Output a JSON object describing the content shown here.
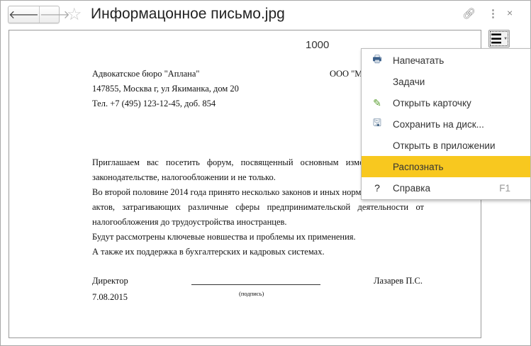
{
  "window": {
    "title": "Информацонное письмо.jpg",
    "back_icon": "arrow-left",
    "forward_icon": "arrow-right",
    "favorite_icon": "star",
    "link_icon": "link",
    "more_icon": "more-vertical",
    "close_icon": "close"
  },
  "document": {
    "page_number": "1000",
    "sender": [
      "Адвокатское бюро \"Аплана\"",
      "147855, Москва г, ул Якиманка, дом 20",
      "Тел. +7 (495) 123-12-45, доб. 854"
    ],
    "recipient_fragment": "ООО \"М",
    "body": [
      "Приглашаем вас посетить форум, посвященный основным изменен",
      "законодательстве, налогообложении и не только.",
      "Во второй половине 2014 года принято несколько законов и иных норма",
      "актов, затрагивающих различные сферы предпринимательской деятельности от",
      "налогообложения до трудоустройства иностранцев.",
      "Будут рассмотрены ключевые новшества и проблемы их применения.",
      "А также их поддержка в бухгалтерских и кадровых системах."
    ],
    "position": "Директор",
    "date": "7.08.2015",
    "signature_caption": "(подпись)",
    "signer": "Лазарев П.С."
  },
  "menu": {
    "button_icon": "hamburger-menu",
    "highlight_color": "#f8c81f",
    "items": [
      {
        "label": "Напечатать",
        "icon": "printer"
      },
      {
        "label": "Задачи",
        "icon": ""
      },
      {
        "label": "Открыть карточку",
        "icon": "pencil"
      },
      {
        "label": "Сохранить на диск...",
        "icon": "floppy-disk"
      },
      {
        "label": "Открыть в приложении",
        "icon": ""
      },
      {
        "label": "Распознать",
        "icon": "",
        "highlighted": true
      },
      {
        "label": "Справка",
        "icon": "question",
        "shortcut": "F1"
      }
    ]
  }
}
